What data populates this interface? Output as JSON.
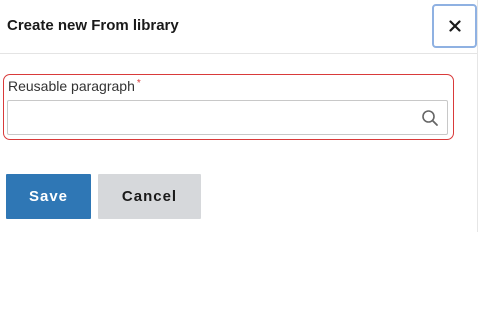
{
  "dialog": {
    "title": "Create new From library",
    "close_icon": "close-icon"
  },
  "field": {
    "label": "Reusable paragraph",
    "required_marker": "*",
    "value": "",
    "placeholder": "",
    "icon": "search-icon"
  },
  "actions": {
    "save_label": "Save",
    "cancel_label": "Cancel"
  },
  "colors": {
    "primary": "#2f77b5",
    "error": "#d93a3a",
    "secondary_button": "#d6d8db",
    "focus_ring": "#8fb1e2"
  }
}
